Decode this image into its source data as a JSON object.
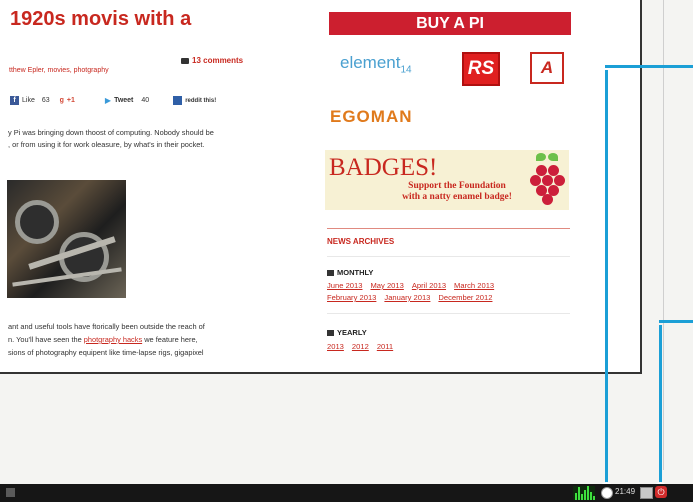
{
  "article": {
    "title": "1920s movis with a",
    "meta": "tthew Epler, movies, photgraphy",
    "comments": "13 comments",
    "share": {
      "like_label": "Like",
      "like_count": "63",
      "gplus_label": "+1",
      "tweet_label": "Tweet",
      "tweet_count": "40",
      "reddit_label": "reddit this!"
    },
    "intro_lines": [
      "y Pi was bringing down thoost of computing. Nobody should be",
      ", or from using it for work oleasure, by what's in their pocket."
    ],
    "lower": {
      "line1": "ant and useful tools have ftorically been outside the reach of",
      "line2_pre": "n. You'll have seen the ",
      "line2_link": "photgraphy hacks",
      "line2_post": " we feature here,",
      "line3": "sions of photography equipent like time-lapse rigs, gigapixel"
    }
  },
  "sidebar": {
    "buy_banner": "BUY A PI",
    "sponsors": {
      "element14": "element",
      "element14_sub": "14",
      "rs": "RS",
      "allied": "A",
      "egoman": "EGOMAN"
    },
    "badges": {
      "title": "BADGES!",
      "line1": "Support the Foundation",
      "line2": "with a natty enamel badge!"
    },
    "news_archives": "NEWS ARCHIVES",
    "monthly_label": "MONTHLY",
    "monthly_row1": [
      "June 2013",
      "May 2013",
      "April 2013",
      "March 2013"
    ],
    "monthly_row2": [
      "February 2013",
      "January 2013",
      "December 2012"
    ],
    "yearly_label": "YEARLY",
    "yearly": [
      "2013",
      "2012",
      "2011"
    ]
  },
  "taskbar": {
    "clock": "21:49",
    "shutdown_glyph": "⏻",
    "cpu_levels": [
      0.5,
      0.9,
      0.4,
      0.7,
      1.0,
      0.6,
      0.3
    ]
  },
  "colors": {
    "accent_red": "#c8281f",
    "callout_blue": "#1b9fd6",
    "taskbar_bg": "#161616"
  },
  "icons": {
    "comments": "comment-bubble-icon",
    "calendar": "calendar-icon",
    "network": "network-icon",
    "cpu": "cpu-monitor-icon",
    "screen": "screen-icon",
    "shutdown": "shutdown-icon"
  }
}
